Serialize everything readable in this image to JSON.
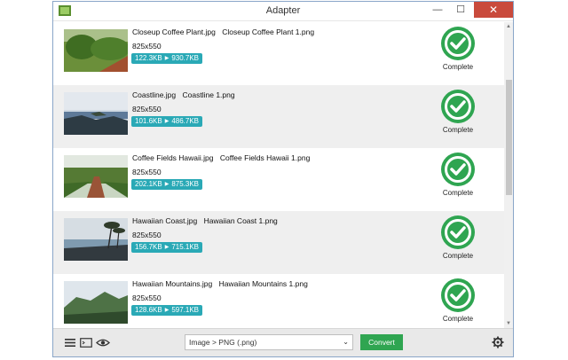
{
  "window": {
    "title": "Adapter"
  },
  "window_controls": {
    "minimize": "—",
    "maximize": "☐",
    "close": "✕"
  },
  "items": [
    {
      "source": "Closeup Coffee Plant.jpg",
      "output": "Closeup Coffee Plant 1.png",
      "dimensions": "825x550",
      "size_before": "122.3KB",
      "size_after": "930.7KB",
      "status": "Complete"
    },
    {
      "source": "Coastline.jpg",
      "output": "Coastline 1.png",
      "dimensions": "825x550",
      "size_before": "101.6KB",
      "size_after": "486.7KB",
      "status": "Complete"
    },
    {
      "source": "Coffee Fields Hawaii.jpg",
      "output": "Coffee Fields Hawaii 1.png",
      "dimensions": "825x550",
      "size_before": "202.1KB",
      "size_after": "875.3KB",
      "status": "Complete"
    },
    {
      "source": "Hawaiian Coast.jpg",
      "output": "Hawaiian Coast 1.png",
      "dimensions": "825x550",
      "size_before": "156.7KB",
      "size_after": "715.1KB",
      "status": "Complete"
    },
    {
      "source": "Hawaiian Mountains.jpg",
      "output": "Hawaiian Mountains 1.png",
      "dimensions": "825x550",
      "size_before": "128.6KB",
      "size_after": "597.1KB",
      "status": "Complete"
    }
  ],
  "icons": {
    "app": "app-icon",
    "list_menu": "hamburger-icon",
    "console": "terminal-icon",
    "preview": "eye-icon",
    "settings": "gear-icon",
    "status": "checkmark-circle-icon"
  },
  "bottombar": {
    "format_selected": "Image > PNG (.png)",
    "convert_label": "Convert"
  },
  "colors": {
    "accent_teal": "#2aa9b6",
    "success_green": "#2fa551",
    "close_red": "#c94a3c"
  }
}
